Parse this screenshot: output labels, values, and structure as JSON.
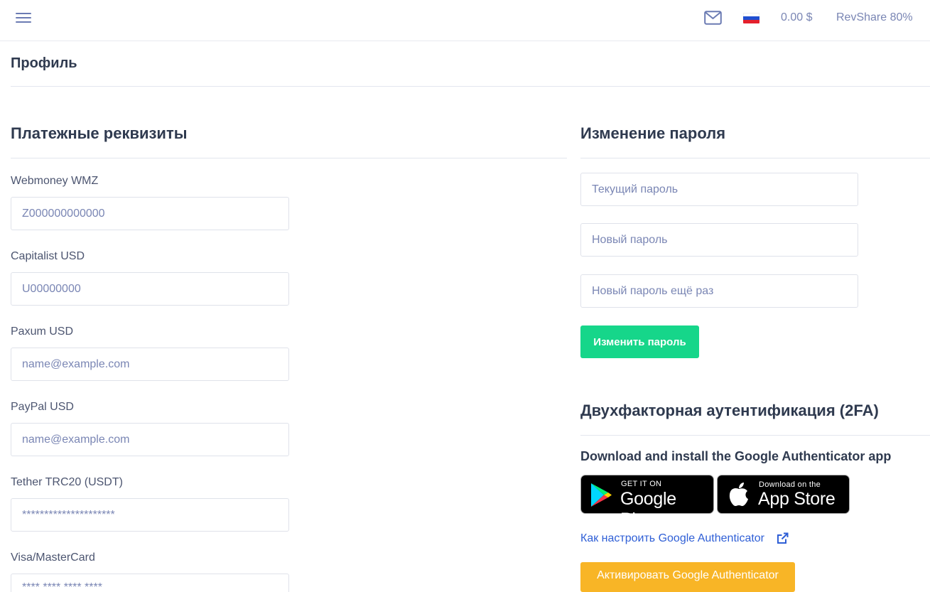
{
  "header": {
    "balance": "0.00 $",
    "revshare": "RevShare 80%",
    "menu_icon": "hamburger-icon",
    "mail_icon": "mail-icon",
    "flag_icon": "flag-ru-icon"
  },
  "page": {
    "title": "Профиль"
  },
  "payment": {
    "title": "Платежные реквизиты",
    "fields": [
      {
        "label": "Webmoney WMZ",
        "placeholder": "Z000000000000"
      },
      {
        "label": "Capitalist USD",
        "placeholder": "U00000000"
      },
      {
        "label": "Paxum USD",
        "placeholder": "name@example.com"
      },
      {
        "label": "PayPal USD",
        "placeholder": "name@example.com"
      },
      {
        "label": "Tether TRC20 (USDT)",
        "placeholder": "*********************"
      },
      {
        "label": "Visa/MasterCard",
        "placeholder": "**** **** **** ****"
      }
    ]
  },
  "password": {
    "title": "Изменение пароля",
    "current_placeholder": "Текущий пароль",
    "new_placeholder": "Новый пароль",
    "repeat_placeholder": "Новый пароль ещё раз",
    "submit_label": "Изменить пароль"
  },
  "twofa": {
    "title": "Двухфакторная аутентификация (2FA)",
    "hint": "Download and install the Google Authenticator app",
    "google_play_small": "GET IT ON",
    "google_play_big": "Google Play",
    "app_store_small": "Download on the",
    "app_store_big": "App Store",
    "howto_link": "Как настроить Google Authenticator",
    "activate_label": "Активировать Google Authenticator"
  },
  "colors": {
    "accent_green": "#16d68a",
    "accent_yellow": "#f8b526",
    "link": "#2f5fd6",
    "muted": "#7a86b4"
  }
}
